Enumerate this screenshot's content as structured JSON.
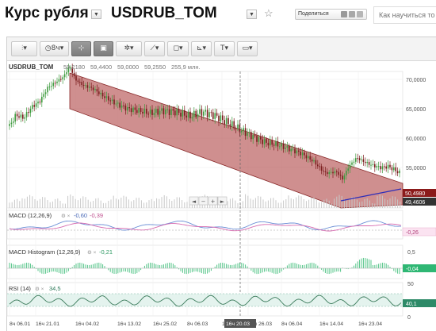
{
  "header": {
    "title": "Курс рубля",
    "symbol": "USDRUB_TOM",
    "share_label": "Поделиться",
    "search_placeholder": "Как научиться то"
  },
  "toolbar": {
    "period_label": "8ч"
  },
  "legend": {
    "symbol": "USDRUB_TOM",
    "open": "59,2180",
    "high": "59,4400",
    "low": "59,0000",
    "close": "59,2550",
    "volume": "255,9 млн."
  },
  "price_axis": [
    "70,0000",
    "65,0000",
    "60,0000",
    "55,0000"
  ],
  "price_tags": {
    "last": "50,4980",
    "line": "49,4606"
  },
  "macd": {
    "label": "MACD (12,26,9)",
    "v1": "-0,60",
    "v2": "-0,39",
    "tag": "-0,26"
  },
  "macd_hist": {
    "label": "MACD Histogram (12,26,9)",
    "value": "-0,21",
    "tag": "-0,04",
    "axis": [
      "0,5",
      "0"
    ]
  },
  "rsi": {
    "label": "RSI (14)",
    "value": "34,5",
    "tag": "40,1",
    "axis": [
      "50",
      "0"
    ]
  },
  "time_axis": [
    "8ч 06.01",
    "16ч 21.01",
    "16ч 04.02",
    "16ч 13.02",
    "16ч 25.02",
    "8ч 06.03",
    "16ч 20.03",
    "16ч 26.03",
    "8ч 06.04",
    "16ч 14.04",
    "16ч 23.04"
  ],
  "crosshair_time": "16ч 20.03",
  "colors": {
    "channel": "#b24a4a",
    "candle_up": "#3f9b3f",
    "candle_down": "#7a1d1d",
    "macd_line": "#6b8fd6",
    "signal_line": "#d66bb0",
    "hist": "#52c487",
    "rsi_line": "#3a7a5a",
    "trend": "#2e2eb8"
  }
}
